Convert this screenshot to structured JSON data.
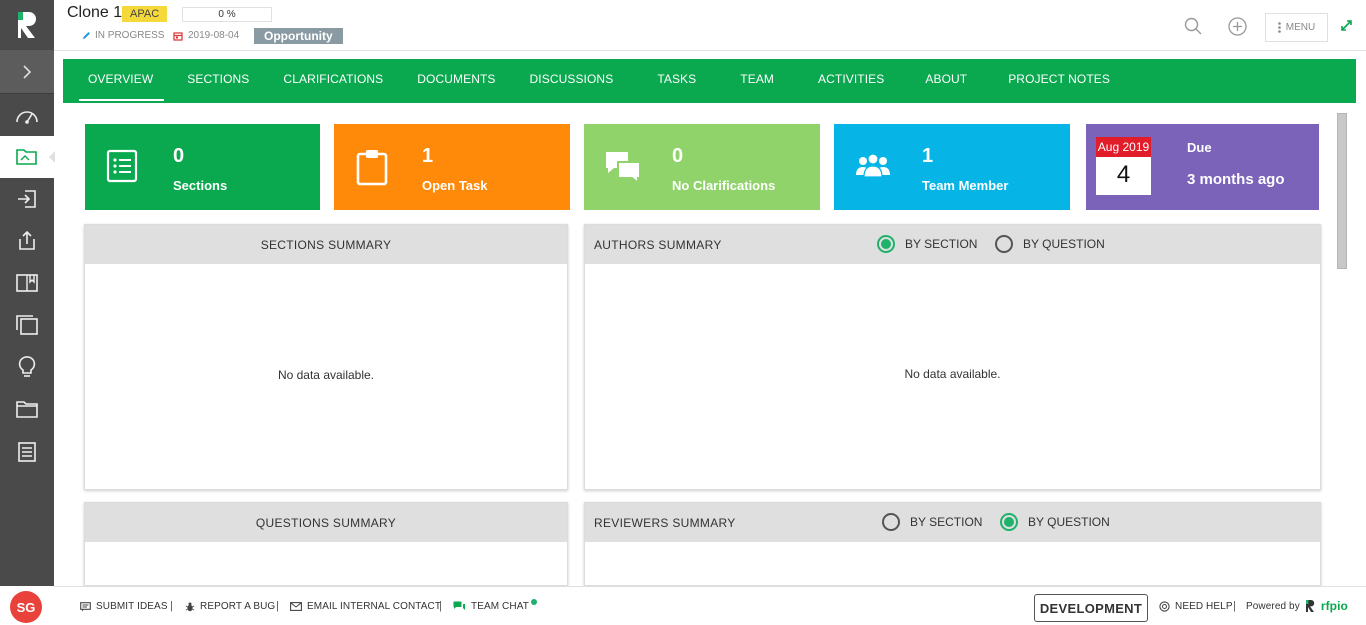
{
  "header": {
    "title": "Clone 1",
    "region": "APAC",
    "progress": "0 %",
    "status": "IN PROGRESS",
    "date": "2019-08-04",
    "type": "Opportunity",
    "menu_label": "MENU"
  },
  "tabs": [
    {
      "label": "OVERVIEW"
    },
    {
      "label": "SECTIONS"
    },
    {
      "label": "CLARIFICATIONS"
    },
    {
      "label": "DOCUMENTS"
    },
    {
      "label": "DISCUSSIONS"
    },
    {
      "label": "TASKS"
    },
    {
      "label": "TEAM"
    },
    {
      "label": "ACTIVITIES"
    },
    {
      "label": "ABOUT"
    },
    {
      "label": "PROJECT NOTES"
    }
  ],
  "cards": {
    "sections": {
      "value": "0",
      "label": "Sections",
      "color": "#0aa84f",
      "icon": "list-icon"
    },
    "tasks": {
      "value": "1",
      "label": "Open Task",
      "color": "#ff8a0a",
      "icon": "clipboard-icon"
    },
    "clarifications": {
      "value": "0",
      "label": "No Clarifications",
      "color": "#8fd36a",
      "icon": "chat-bubbles-icon"
    },
    "team": {
      "value": "1",
      "label": "Team Member",
      "color": "#06b5e6",
      "icon": "people-icon"
    },
    "due": {
      "month": "Aug 2019",
      "day": "4",
      "label": "Due",
      "value": "3 months ago",
      "color": "#7a63b9"
    }
  },
  "panels": {
    "sections_summary": {
      "title": "SECTIONS SUMMARY",
      "empty": "No data available."
    },
    "authors_summary": {
      "title": "AUTHORS SUMMARY",
      "empty": "No data available.",
      "by_section": "BY SECTION",
      "by_question": "BY QUESTION",
      "selected": "BY SECTION"
    },
    "questions_summary": {
      "title": "QUESTIONS SUMMARY"
    },
    "reviewers_summary": {
      "title": "REVIEWERS SUMMARY",
      "by_section": "BY SECTION",
      "by_question": "BY QUESTION",
      "selected": "BY QUESTION"
    }
  },
  "user": {
    "initials": "SG"
  },
  "footer": {
    "submit_ideas": "SUBMIT IDEAS",
    "report_bug": "REPORT A BUG",
    "email_contact": "EMAIL INTERNAL CONTACT",
    "team_chat": "TEAM CHAT",
    "environment": "DEVELOPMENT",
    "need_help": "NEED HELP",
    "powered_by": "Powered by",
    "brand": "rfpio"
  },
  "colors": {
    "brand_green": "#0aa84f",
    "sidebar": "#4a4a4a",
    "accent_red": "#e8423a"
  }
}
